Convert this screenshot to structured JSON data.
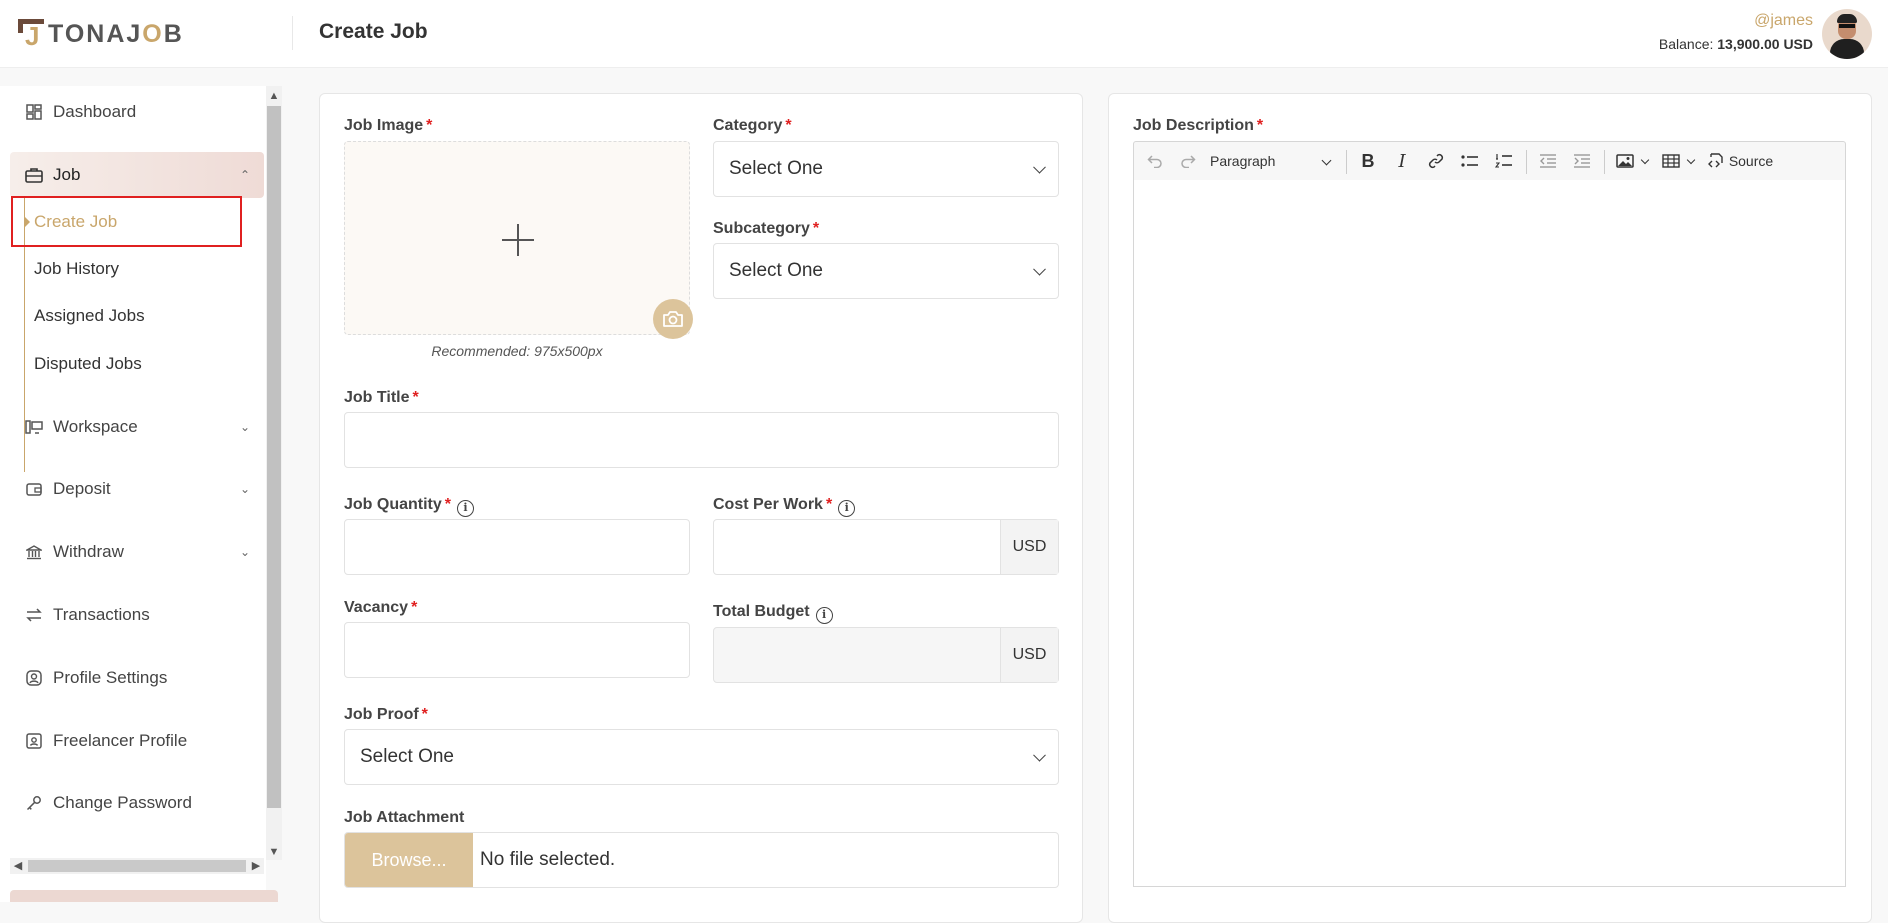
{
  "header": {
    "logo_text_pre": "TONAJ",
    "logo_text_o": "O",
    "logo_text_post": "B",
    "logo_mark_letter": "J",
    "page_title": "Create Job",
    "username": "@james",
    "balance_label": "Balance:",
    "balance_value": "13,900.00 USD"
  },
  "sidebar": {
    "items": [
      {
        "label": "Dashboard",
        "icon": "dashboard-icon"
      },
      {
        "label": "Job",
        "icon": "briefcase-icon"
      },
      {
        "label": "Workspace",
        "icon": "workspace-icon"
      },
      {
        "label": "Deposit",
        "icon": "wallet-icon"
      },
      {
        "label": "Withdraw",
        "icon": "bank-icon"
      },
      {
        "label": "Transactions",
        "icon": "transfer-icon"
      },
      {
        "label": "Profile Settings",
        "icon": "user-circle-icon"
      },
      {
        "label": "Freelancer Profile",
        "icon": "id-card-icon"
      },
      {
        "label": "Change Password",
        "icon": "key-icon"
      }
    ],
    "job_sub": [
      "Create Job",
      "Job History",
      "Assigned Jobs",
      "Disputed Jobs"
    ]
  },
  "form": {
    "job_image_label": "Job Image",
    "recommended": "Recommended: 975x500px",
    "category_label": "Category",
    "category_value": "Select One",
    "subcategory_label": "Subcategory",
    "subcategory_value": "Select One",
    "job_title_label": "Job Title",
    "job_quantity_label": "Job Quantity",
    "cost_per_work_label": "Cost Per Work",
    "currency": "USD",
    "vacancy_label": "Vacancy",
    "total_budget_label": "Total Budget",
    "job_proof_label": "Job Proof",
    "job_proof_value": "Select One",
    "job_attachment_label": "Job Attachment",
    "browse_label": "Browse...",
    "no_file": "No file selected.",
    "required_mark": "*",
    "info_mark": "i"
  },
  "editor": {
    "label": "Job Description",
    "paragraph": "Paragraph",
    "source": "Source"
  },
  "colors": {
    "accent": "#c9a66b",
    "required": "#e02020",
    "highlight_box": "#e02020"
  }
}
